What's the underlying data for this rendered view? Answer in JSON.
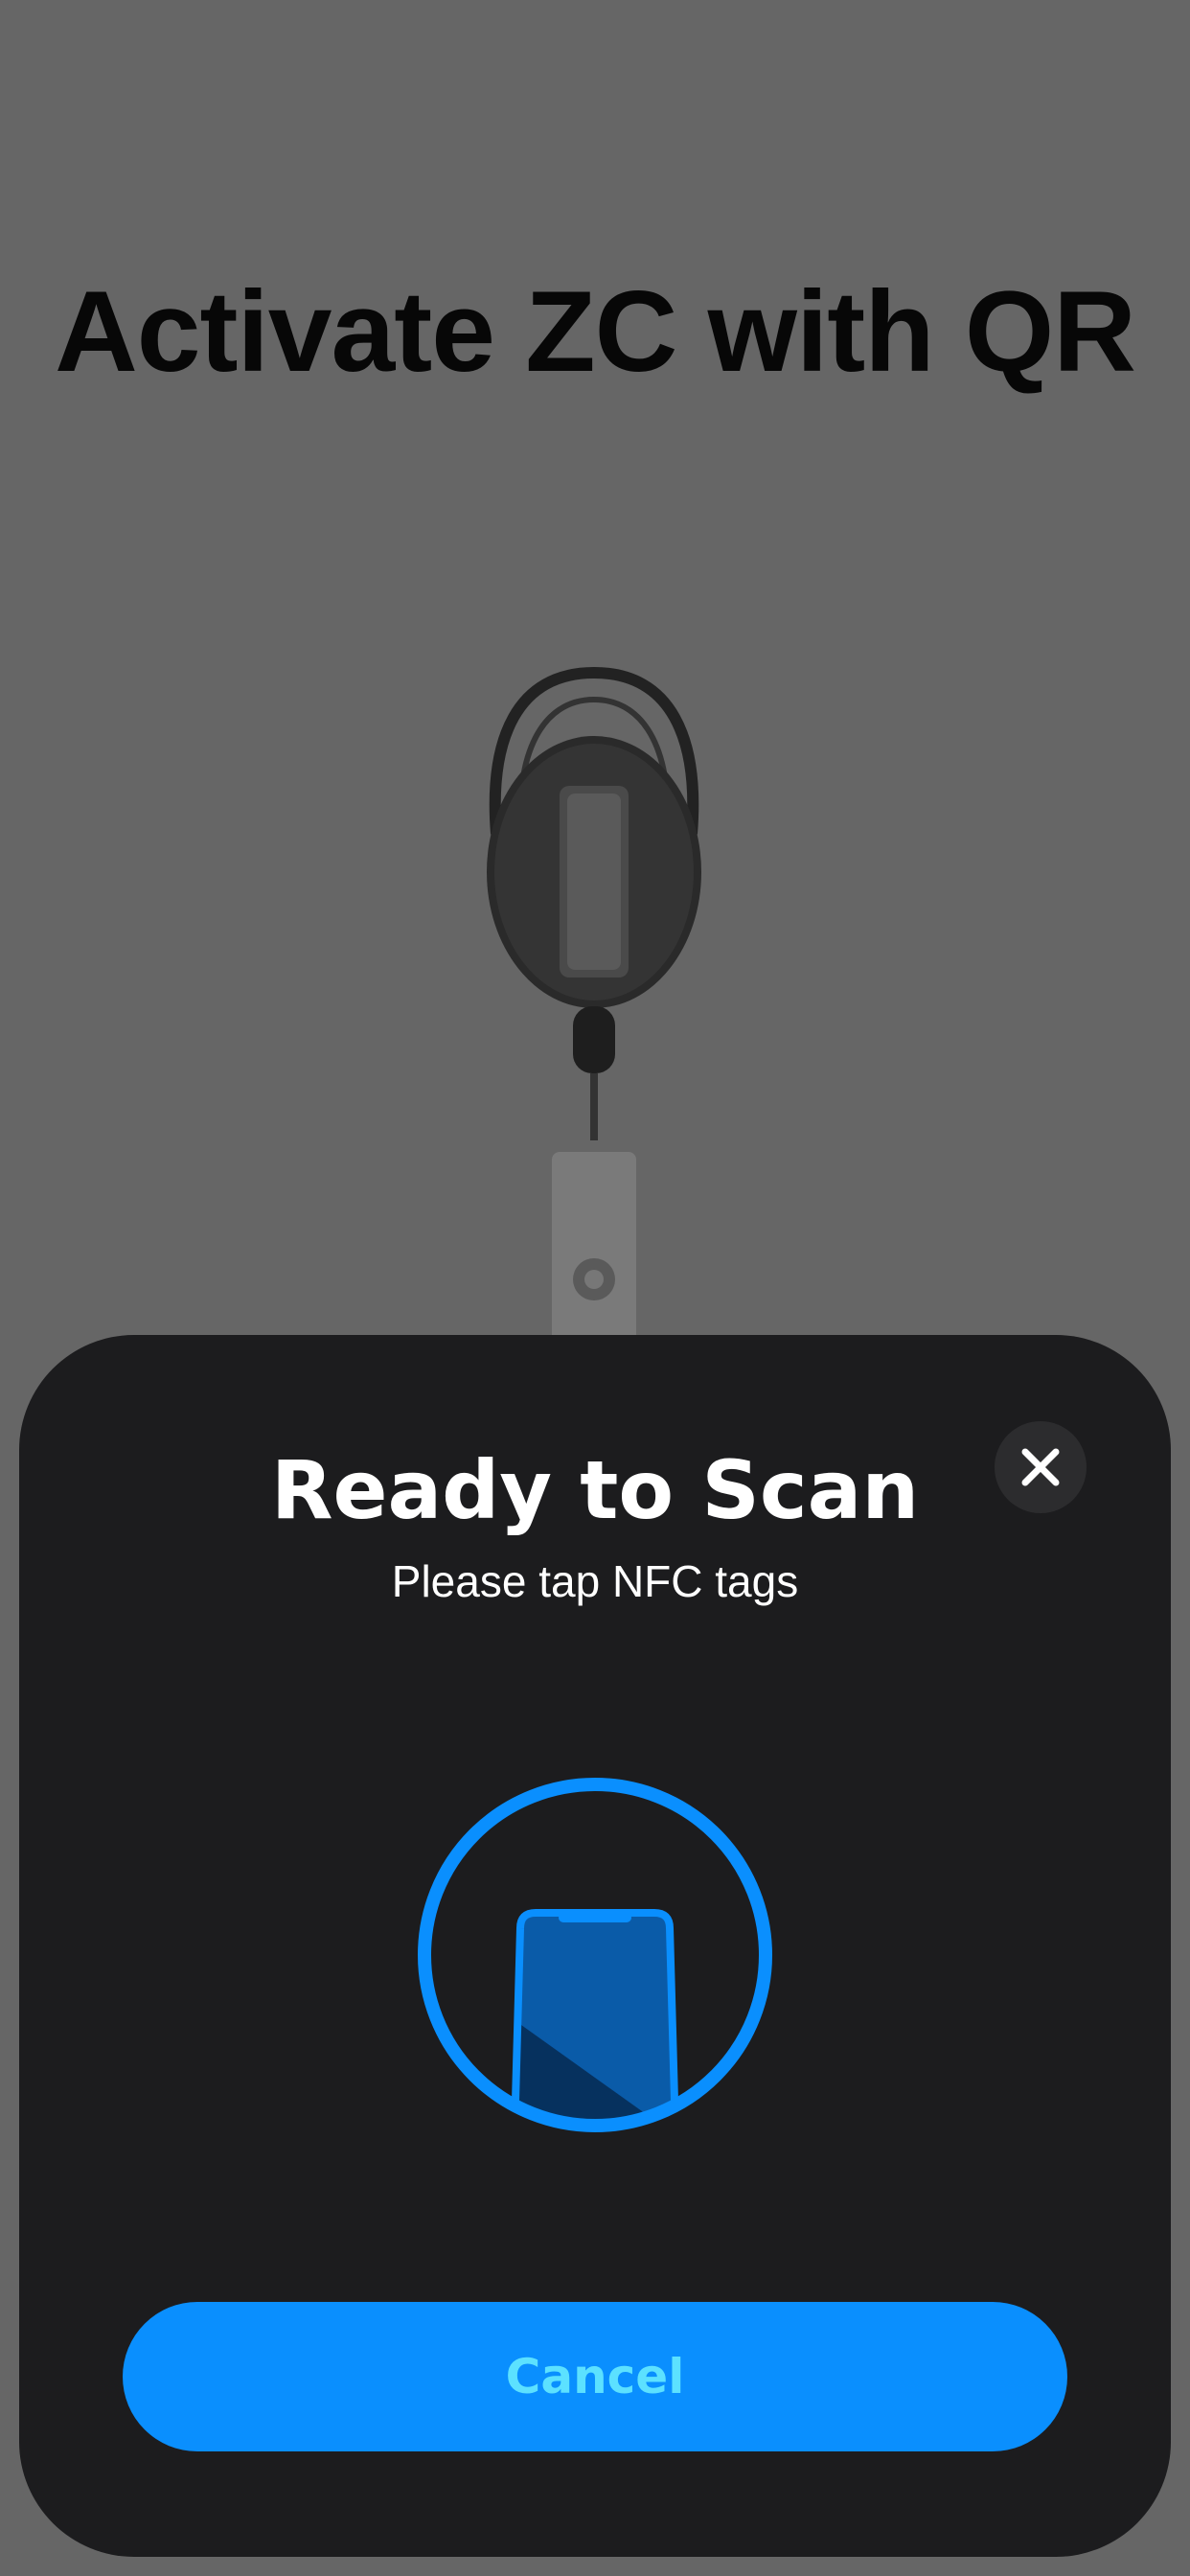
{
  "background": {
    "title": "Activate ZC with QR",
    "image": "badge-reel-photo"
  },
  "scan_sheet": {
    "title": "Ready to Scan",
    "subtitle": "Please tap NFC tags",
    "close_icon": "close-icon",
    "graphic_icon": "phone-in-circle-icon",
    "cancel_label": "Cancel"
  },
  "colors": {
    "overlay": "#666666",
    "sheet": "#1c1c1e",
    "accent": "#0a8ffe",
    "cancel_text": "#5ce1ff"
  }
}
